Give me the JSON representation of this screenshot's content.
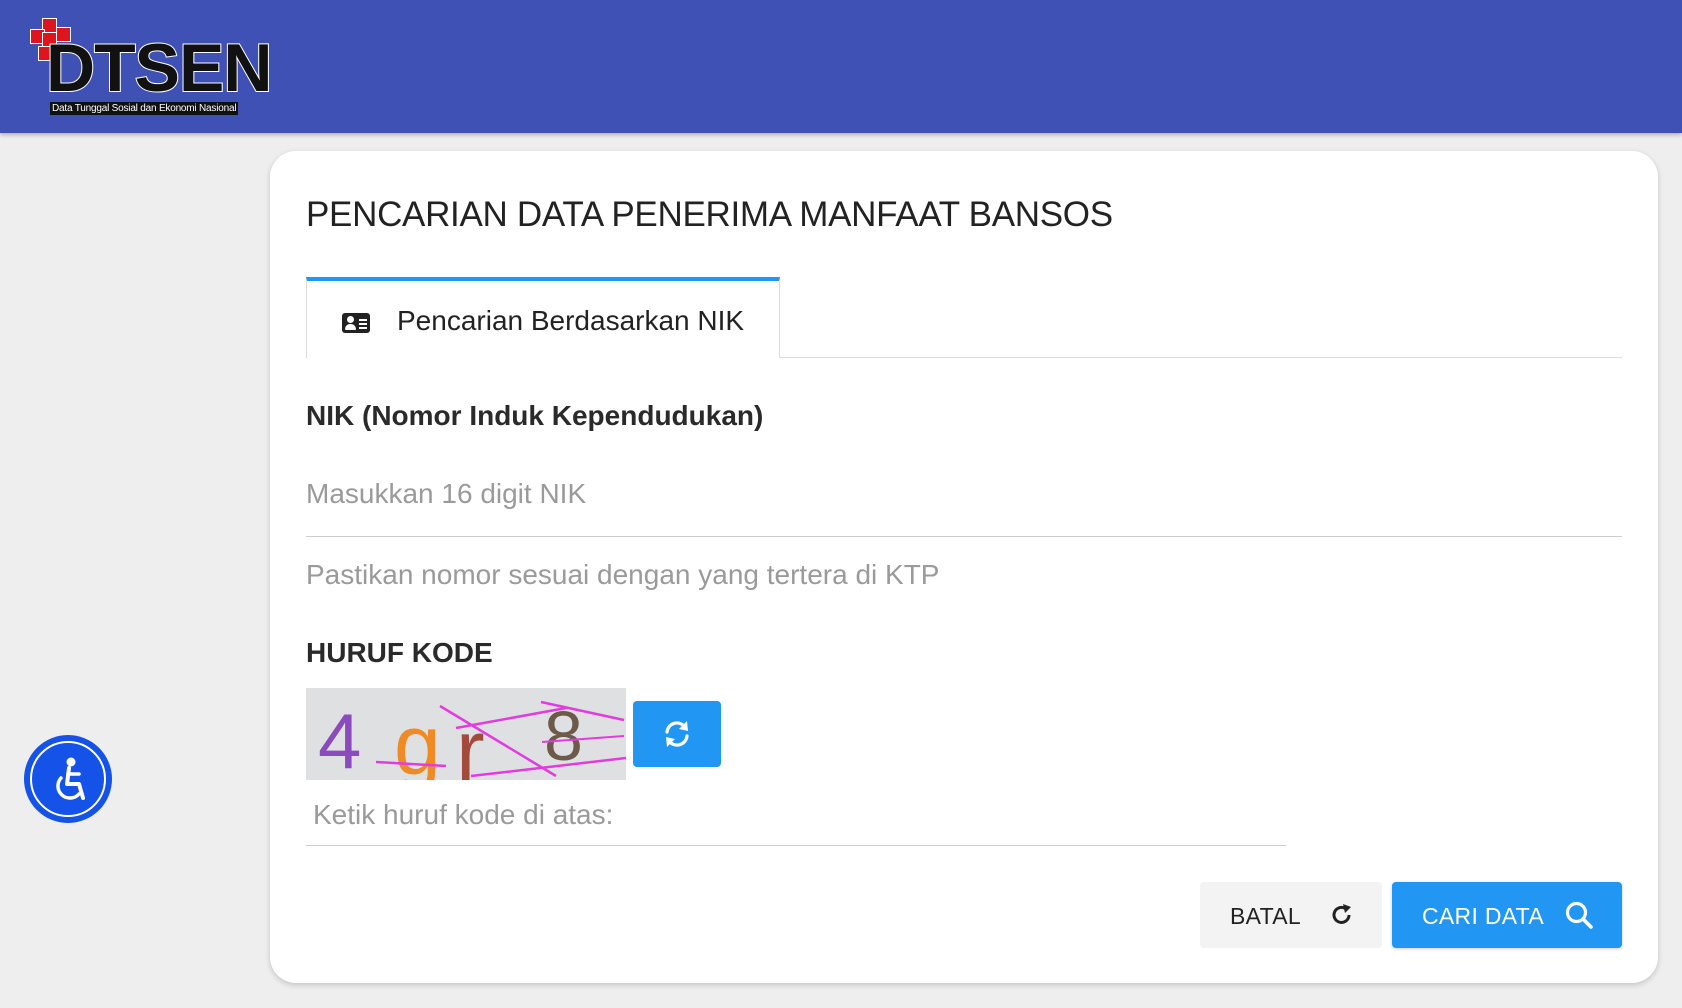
{
  "header": {
    "logo_text": "DTSEN",
    "logo_subtitle": "Data Tunggal Sosial dan Ekonomi Nasional",
    "background_color": "#3f51b5"
  },
  "main": {
    "title": "PENCARIAN DATA PENERIMA MANFAAT BANSOS",
    "tabs": [
      {
        "label": "Pencarian Berdasarkan NIK",
        "icon": "id-card-icon",
        "active": true
      }
    ],
    "nik": {
      "label": "NIK (Nomor Induk Kependudukan)",
      "placeholder": "Masukkan 16 digit NIK",
      "value": "",
      "hint": "Pastikan nomor sesuai dengan yang tertera di KTP"
    },
    "captcha": {
      "label": "HURUF KODE",
      "characters": [
        "4",
        "g",
        "r",
        "8"
      ],
      "refresh_icon": "refresh-icon",
      "placeholder": "Ketik huruf kode di atas:",
      "value": ""
    },
    "buttons": {
      "cancel_label": "BATAL",
      "cancel_icon": "redo-icon",
      "search_label": "CARI DATA",
      "search_icon": "search-icon"
    }
  },
  "accessibility": {
    "icon": "accessibility-icon"
  },
  "colors": {
    "accent": "#2196f3",
    "logo_red": "#e0141e",
    "widget_blue": "#1452e8"
  }
}
